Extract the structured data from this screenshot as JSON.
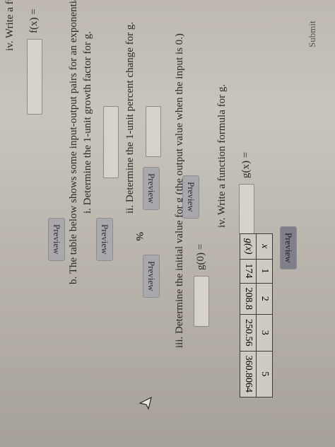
{
  "part_a_iv": {
    "instruction": "iv. Write a function formula for f.",
    "input_label": "f(x) =",
    "preview_label": "Preview"
  },
  "part_b": {
    "intro": "b. The table below shows some input-output pairs for an exponential function g.",
    "table": {
      "x_label": "x",
      "gx_label": "g(x)",
      "x_values": [
        "1",
        "2",
        "3",
        "5"
      ],
      "g_values": [
        "174",
        "208.8",
        "250.56",
        "360.8064"
      ]
    },
    "i": {
      "instruction": "i. Determine the 1-unit growth factor for g.",
      "preview_label": "Preview"
    },
    "ii": {
      "instruction": "ii. Determine the 1-unit percent change for g.",
      "preview_label": "Preview",
      "percent_sign": "%",
      "preview2_label": "Preview"
    },
    "iii": {
      "instruction": "iii. Determine the initial value for g (the output value when the input is 0.)",
      "input_label": "g(0) =",
      "preview_label": "Preview"
    },
    "iv": {
      "instruction": "iv. Write a function formula for g.",
      "input_label": "g(x) =",
      "preview_label": "Preview"
    }
  },
  "submit_label": "Submit",
  "cursor_icon": "mouse-pointer-icon"
}
